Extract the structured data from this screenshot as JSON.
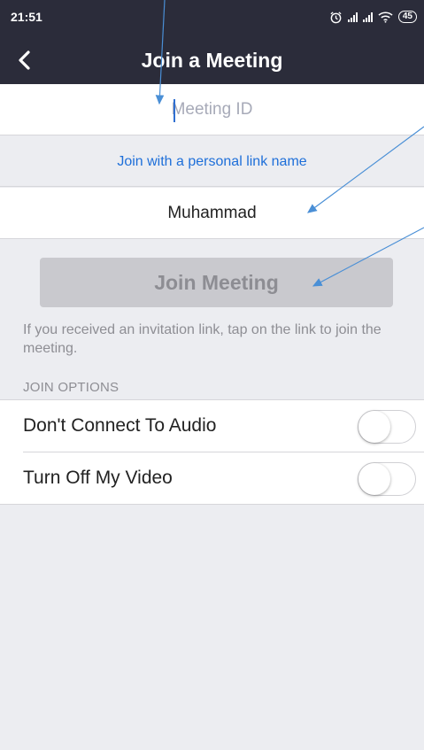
{
  "status_bar": {
    "time": "21:51",
    "battery": "45",
    "icons": [
      "alarm-icon",
      "signal-icon",
      "signal-icon",
      "wifi-icon",
      "battery-icon"
    ]
  },
  "header": {
    "title": "Join a Meeting",
    "back_icon": "chevron-left-icon"
  },
  "form": {
    "meeting_id": {
      "value": "",
      "placeholder": "Meeting ID"
    },
    "personal_link_label": "Join with a personal link name",
    "display_name": "Muhammad",
    "join_button_label": "Join Meeting",
    "hint": "If you received an invitation link, tap on the link to join the meeting."
  },
  "join_options": {
    "title": "JOIN OPTIONS",
    "items": [
      {
        "label": "Don't Connect To Audio",
        "enabled": false
      },
      {
        "label": "Turn Off My Video",
        "enabled": false
      }
    ]
  },
  "colors": {
    "header_bg": "#2b2c3a",
    "link": "#1e6fd9",
    "disabled_button": "#c9c9ce",
    "background": "#ecedf1",
    "annotation_arrow": "#4a8fd6"
  }
}
